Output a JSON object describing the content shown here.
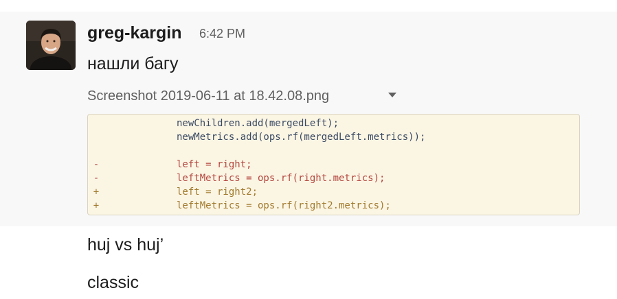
{
  "message": {
    "username": "greg-kargin",
    "timestamp": "6:42 PM",
    "lines": [
      "нашли багу",
      "huj vs huj’",
      "classic"
    ],
    "file": {
      "name": "Screenshot 2019-06-11 at 18.42.08.png",
      "code_lines": [
        {
          "marker": "",
          "text": "newChildren.add(mergedLeft);"
        },
        {
          "marker": "",
          "text": "newMetrics.add(ops.rf(mergedLeft.metrics));"
        },
        {
          "marker": "",
          "text": ""
        },
        {
          "marker": "-",
          "text": "left = right;"
        },
        {
          "marker": "-",
          "text": "leftMetrics = ops.rf(right.metrics);"
        },
        {
          "marker": "+",
          "text": "left = right2;"
        },
        {
          "marker": "+",
          "text": "leftMetrics = ops.rf(right2.metrics);"
        }
      ]
    }
  },
  "colors": {
    "message_background": "#f8f8f8",
    "preview_background": "#fbf5e4",
    "deleted_line": "#b4463e",
    "added_line": "#a17a2c",
    "context_line": "#3a4a63"
  },
  "icons": {
    "file_menu": "caret-down-icon",
    "avatar": "user-avatar"
  }
}
